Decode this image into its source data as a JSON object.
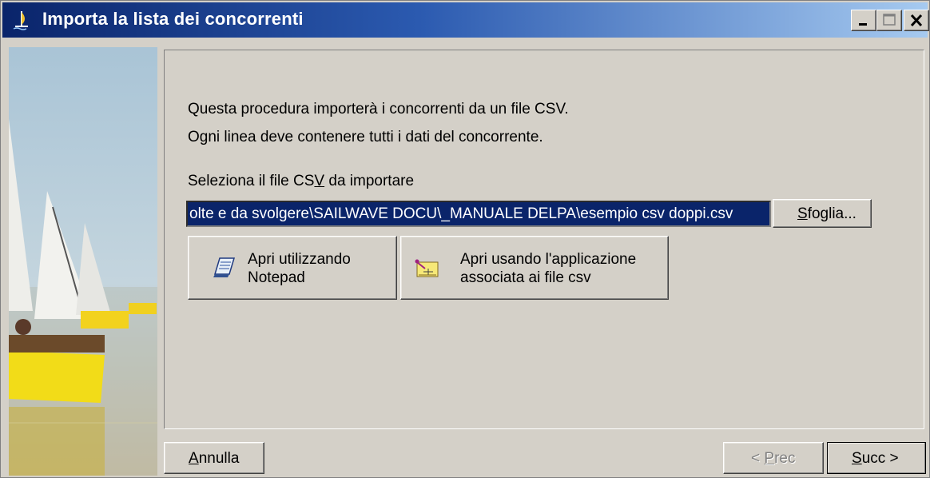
{
  "window": {
    "title": "Importa la lista dei concorrenti"
  },
  "content": {
    "intro_line1": "Questa procedura importerà i concorrenti da un file CSV.",
    "intro_line2": " Ogni linea deve contenere tutti i dati del concorrente.",
    "select_label_pre": "Seleziona il file CS",
    "select_label_key": "V",
    "select_label_post": " da importare",
    "file_path": "olte e da svolgere\\SAILWAVE DOCU\\_MANUALE DELPA\\esempio csv doppi.csv",
    "browse_key": "S",
    "browse_rest": "foglia...",
    "open_notepad_line1": "Apri utilizzando",
    "open_notepad_line2": "Notepad",
    "open_assoc_line1": "Apri usando l'applicazione",
    "open_assoc_line2": "associata ai file csv"
  },
  "footer": {
    "cancel_key": "A",
    "cancel_rest": "nnulla",
    "prev_pre": "< ",
    "prev_key": "P",
    "prev_rest": "rec",
    "next_key": "S",
    "next_rest": "ucc >"
  },
  "icons": {
    "app": "sailboat-icon",
    "minimize": "minimize-icon",
    "maximize": "maximize-icon",
    "close": "close-icon",
    "notepad": "notepad-icon",
    "associated_app": "spreadsheet-icon"
  },
  "colors": {
    "title_start": "#0a246a",
    "title_end": "#a6caf0",
    "face": "#d4d0c8",
    "selection": "#0a246a"
  }
}
